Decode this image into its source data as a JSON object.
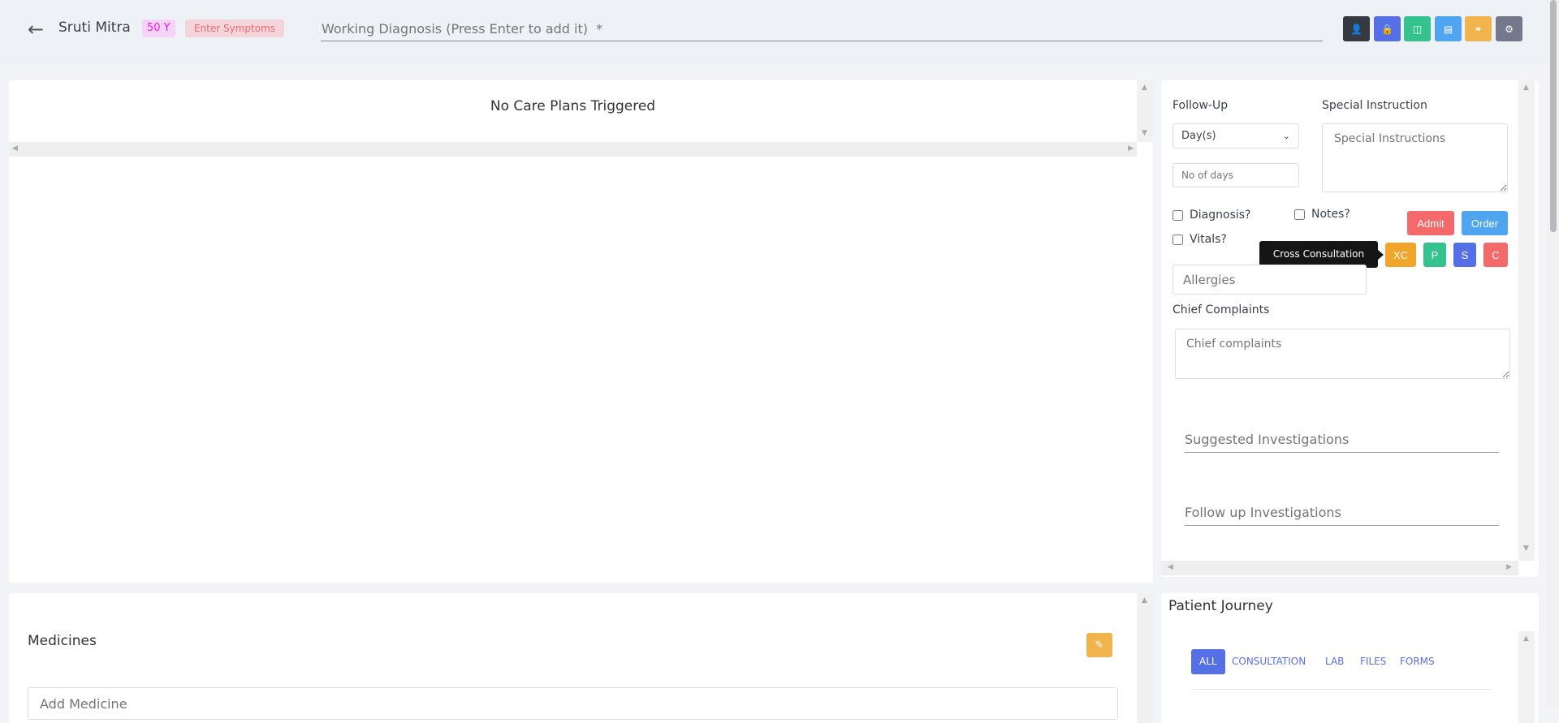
{
  "header": {
    "back_icon": "arrow-left-icon",
    "patient_name": "Sruti Mitra",
    "age_badge": "50 Y",
    "symptoms_badge": "Enter Symptoms",
    "diagnosis_placeholder": "Working Diagnosis (Press Enter to add it)  *",
    "buttons": [
      {
        "icon": "user-voice-icon",
        "color": "#343a40"
      },
      {
        "icon": "lock-icon",
        "color": "#5570e6"
      },
      {
        "icon": "layout-icon",
        "color": "#34c38f"
      },
      {
        "icon": "document-icon",
        "color": "#50a5f1"
      },
      {
        "icon": "bandage-icon",
        "color": "#f1b44c"
      },
      {
        "icon": "gear-icon",
        "color": "#74788d"
      }
    ]
  },
  "care_plans": {
    "title": "No Care Plans Triggered"
  },
  "followup": {
    "label": "Follow-Up",
    "select_value": "Day(s)",
    "days_placeholder": "No of days",
    "special_label": "Special Instruction",
    "special_placeholder": "Special Instructions",
    "checkboxes": {
      "diagnosis": "Diagnosis?",
      "notes": "Notes?",
      "vitals": "Vitals?"
    },
    "admit": "Admit",
    "order": "Order",
    "tooltip": "Cross Consultation",
    "small_buttons": [
      {
        "label": "XC",
        "color": "#f1a52a"
      },
      {
        "label": "P",
        "color": "#34c38f"
      },
      {
        "label": "S",
        "color": "#5570e6"
      },
      {
        "label": "C",
        "color": "#f46a6a"
      }
    ],
    "allergies_placeholder": "Allergies",
    "chief_label": "Chief Complaints",
    "chief_placeholder": "Chief complaints",
    "suggested_placeholder": "Suggested Investigations",
    "followup_inv_placeholder": "Follow up Investigations"
  },
  "medicines": {
    "title": "Medicines",
    "edit_icon": "pencil-icon",
    "add_placeholder": "Add Medicine"
  },
  "journey": {
    "title": "Patient Journey",
    "tabs": [
      "ALL",
      "CONSULTATION",
      "LAB",
      "FILES",
      "FORMS"
    ],
    "active_tab": "ALL"
  },
  "colors": {
    "admit": "#f46a6a",
    "order": "#50a5f1",
    "accent": "#5570e6",
    "edit": "#f1b44c"
  }
}
